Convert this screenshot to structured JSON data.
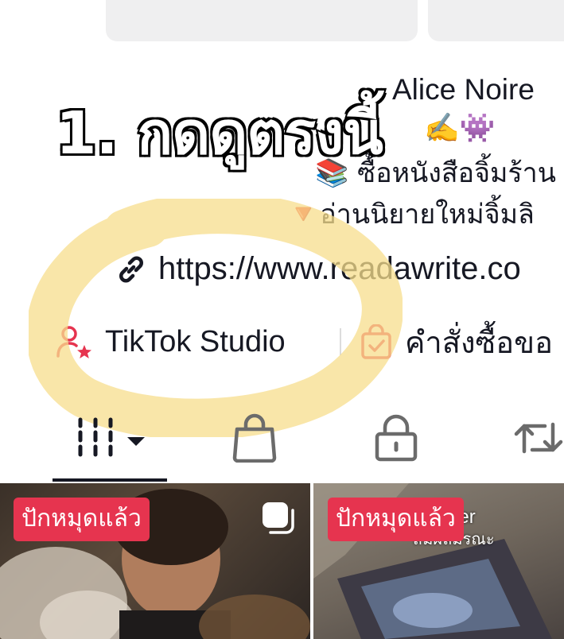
{
  "profile": {
    "display_name": "Alice Noire",
    "name_emojis": "✍️👾",
    "bio": {
      "line1": "📚 ซื้อหนังสือจิ้มร้าน",
      "line2": "🔻อ่านนิยายใหม่จิ้มลิ"
    },
    "link": "https://www.readawrite.co"
  },
  "overlay": {
    "instruction": "1. กดดูตรงนี้",
    "highlight_color": "#f7dd8c"
  },
  "tools": {
    "studio_label": "TikTok Studio",
    "orders_label": "คำสั่งซื้อขอ"
  },
  "tabs": [
    {
      "icon": "grid-icon",
      "active": true
    },
    {
      "icon": "shopping-bag-icon",
      "active": false
    },
    {
      "icon": "lock-icon",
      "active": false
    },
    {
      "icon": "repost-icon",
      "active": false
    }
  ],
  "videos": [
    {
      "pin_label": "ปักหมุดแล้ว",
      "multi_photo": true
    },
    {
      "pin_label": "ปักหมุดแล้ว",
      "caption_line1": "Danger",
      "caption_line2": "สมผลมรณะ"
    }
  ],
  "colors": {
    "accent_red": "#e6344f",
    "studio_icon": "#e6344f",
    "text": "#161823"
  }
}
